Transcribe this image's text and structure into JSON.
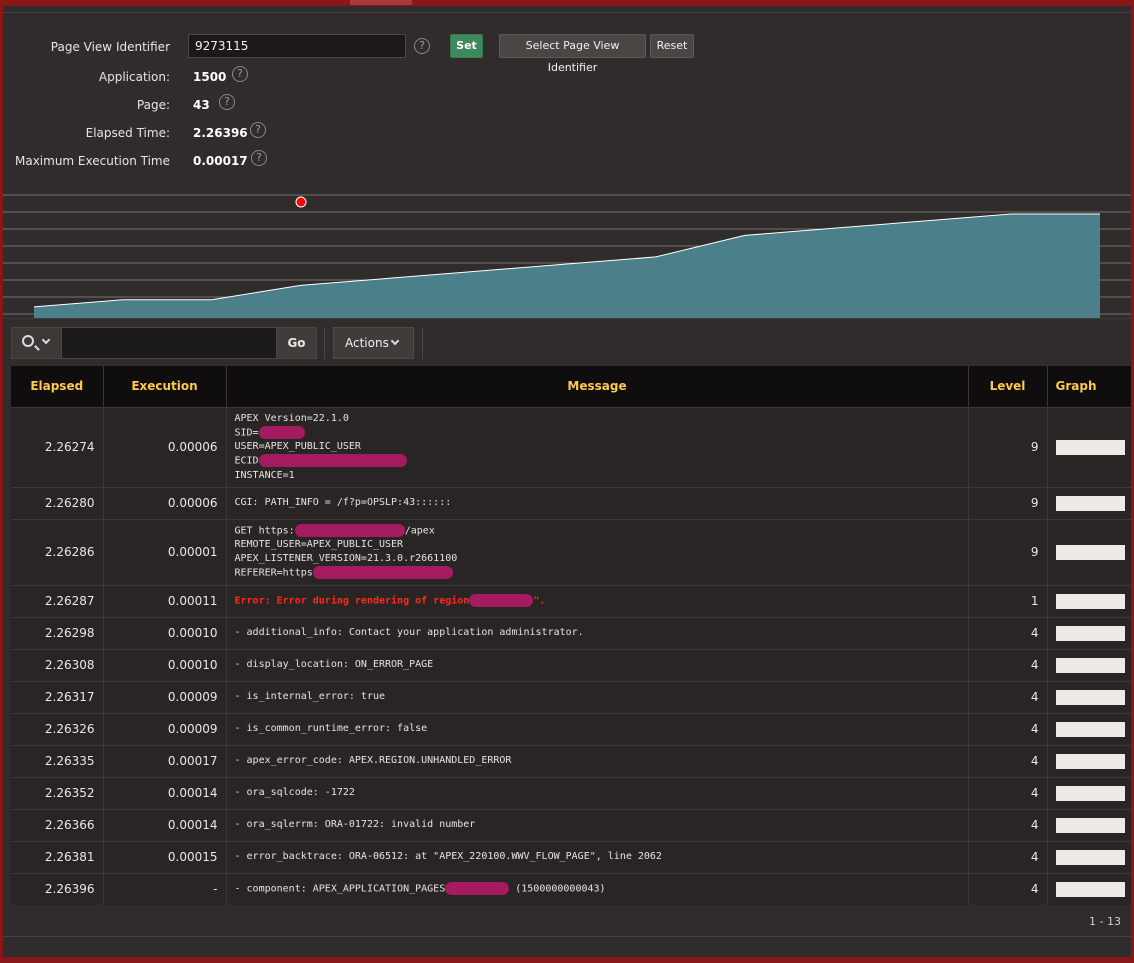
{
  "form": {
    "page_view_identifier_label": "Page View Identifier",
    "page_view_identifier_value": "9273115",
    "set_label": "Set",
    "select_label": "Select Page View Identifier",
    "reset_label": "Reset",
    "application_label": "Application:",
    "application_value": "1500",
    "page_label": "Page:",
    "page_value": "43",
    "elapsed_label": "Elapsed Time:",
    "elapsed_value": "2.26396",
    "max_exec_label": "Maximum Execution Time",
    "max_exec_value": "0.00017",
    "help_glyph": "?"
  },
  "chart_data": {
    "type": "area",
    "x": [
      1,
      2,
      3,
      4,
      5,
      6,
      7,
      8,
      9,
      10,
      11,
      12,
      13
    ],
    "values": [
      1,
      2,
      2,
      4,
      5,
      6,
      7,
      8,
      11,
      12,
      13,
      14,
      14
    ],
    "ylim": [
      0,
      14
    ],
    "grid": true,
    "series_color": "#4b7f8a",
    "marker_color": "#ff0000"
  },
  "toolbar": {
    "go_label": "Go",
    "actions_label": "Actions"
  },
  "table": {
    "headers": [
      "Elapsed",
      "Execution",
      "Message",
      "Level",
      "Graph"
    ],
    "rows": [
      {
        "elapsed": "2.26274",
        "execution": "0.00006",
        "level": "9",
        "lines": [
          "APEX Version=22.1.0",
          "SID=",
          "USER=APEX_PUBLIC_USER",
          "ECID",
          "INSTANCE=1"
        ],
        "error": false
      },
      {
        "elapsed": "2.26280",
        "execution": "0.00006",
        "level": "9",
        "lines": [
          "CGI: PATH_INFO = /f?p=OPSLP:43::::::"
        ],
        "error": false
      },
      {
        "elapsed": "2.26286",
        "execution": "0.00001",
        "level": "9",
        "lines": [
          "GET https:                /apex",
          "REMOTE_USER=APEX_PUBLIC_USER",
          "APEX_LISTENER_VERSION=21.3.0.r2661100",
          "REFERER=https"
        ],
        "error": false
      },
      {
        "elapsed": "2.26287",
        "execution": "0.00011",
        "level": "1",
        "lines": [
          "Error: Error during rendering of region"
        ],
        "error": true
      },
      {
        "elapsed": "2.26298",
        "execution": "0.00010",
        "level": "4",
        "lines": [
          "- additional_info: Contact your application administrator."
        ],
        "error": false
      },
      {
        "elapsed": "2.26308",
        "execution": "0.00010",
        "level": "4",
        "lines": [
          "- display_location: ON_ERROR_PAGE"
        ],
        "error": false
      },
      {
        "elapsed": "2.26317",
        "execution": "0.00009",
        "level": "4",
        "lines": [
          "- is_internal_error: true"
        ],
        "error": false
      },
      {
        "elapsed": "2.26326",
        "execution": "0.00009",
        "level": "4",
        "lines": [
          "- is_common_runtime_error: false"
        ],
        "error": false
      },
      {
        "elapsed": "2.26335",
        "execution": "0.00017",
        "level": "4",
        "lines": [
          "- apex_error_code: APEX.REGION.UNHANDLED_ERROR"
        ],
        "error": false
      },
      {
        "elapsed": "2.26352",
        "execution": "0.00014",
        "level": "4",
        "lines": [
          "- ora_sqlcode: -1722"
        ],
        "error": false
      },
      {
        "elapsed": "2.26366",
        "execution": "0.00014",
        "level": "4",
        "lines": [
          "- ora_sqlerrm: ORA-01722: invalid number"
        ],
        "error": false
      },
      {
        "elapsed": "2.26381",
        "execution": "0.00015",
        "level": "4",
        "lines": [
          "- error_backtrace: ORA-06512: at \"APEX_220100.WWV_FLOW_PAGE\", line 2062"
        ],
        "error": false
      },
      {
        "elapsed": "2.26396",
        "execution": "-",
        "level": "4",
        "lines": [
          "- component: APEX_APPLICATION_PAGES           (1500000000043)"
        ],
        "error": false
      }
    ]
  },
  "pagination": "1 - 13"
}
